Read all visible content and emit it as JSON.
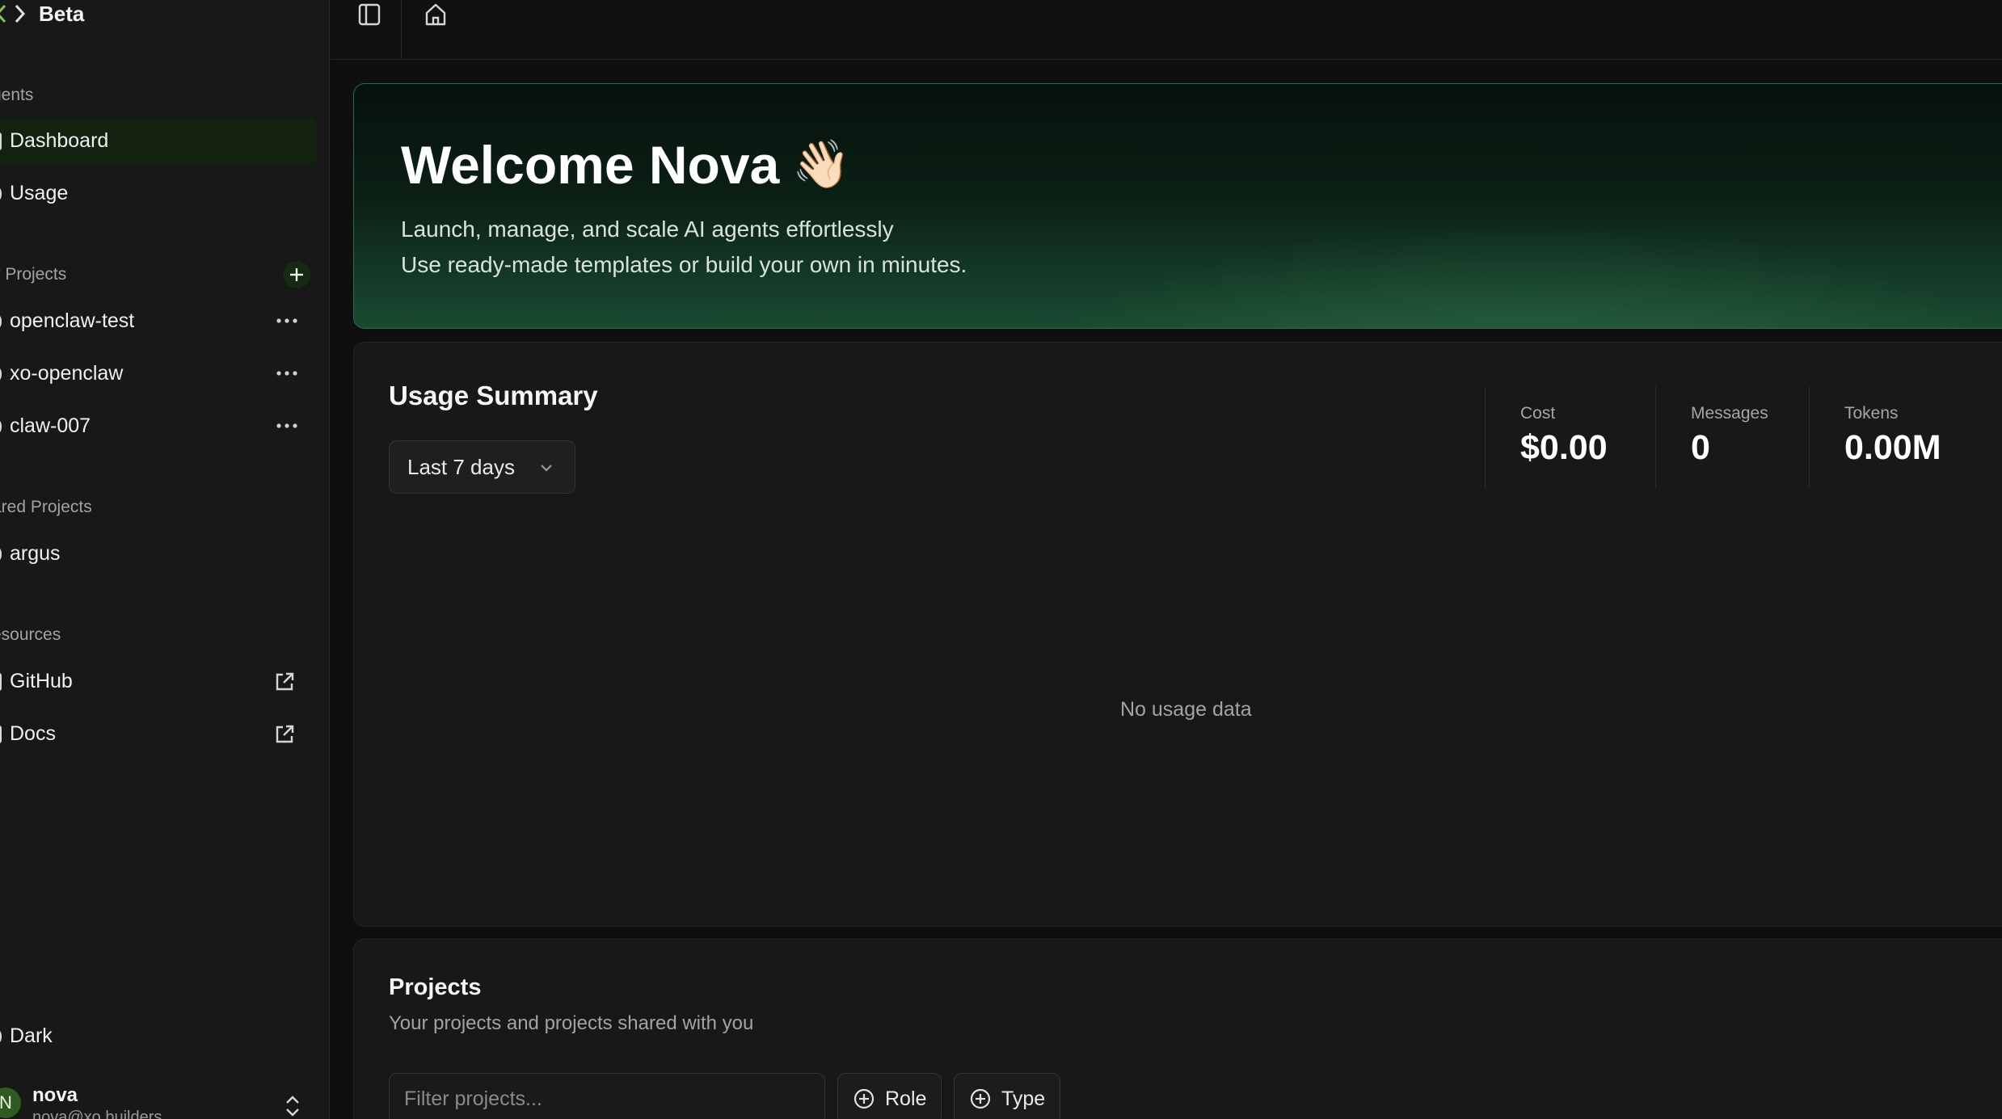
{
  "app": {
    "brand": "Beta"
  },
  "sidebar": {
    "agents_label": "gents",
    "nav": [
      {
        "label": "Dashboard",
        "active": true
      },
      {
        "label": "Usage"
      }
    ],
    "my_projects_label": "y Projects",
    "my_projects": [
      {
        "label": "openclaw-test"
      },
      {
        "label": "xo-openclaw"
      },
      {
        "label": "claw-007"
      }
    ],
    "shared_label": "ared Projects",
    "shared_projects": [
      {
        "label": "argus"
      }
    ],
    "resources_label": "esources",
    "resources": [
      {
        "label": "GitHub",
        "icon": "external-link-icon"
      },
      {
        "label": "Docs",
        "icon": "external-link-icon"
      }
    ],
    "theme_label": "Dark",
    "user": {
      "initial": "N",
      "name": "nova",
      "email": "nova@xo.builders"
    }
  },
  "hero": {
    "title": "Welcome Nova",
    "emoji": "👋🏻",
    "line1": "Launch, manage, and scale AI agents effortlessly",
    "line2": "Use ready-made templates or build your own in minutes."
  },
  "usage": {
    "title": "Usage Summary",
    "range": "Last 7 days",
    "stats": [
      {
        "label": "Cost",
        "value": "$0.00"
      },
      {
        "label": "Messages",
        "value": "0"
      },
      {
        "label": "Tokens",
        "value": "0.00M"
      }
    ],
    "empty": "No usage data"
  },
  "projects": {
    "title": "Projects",
    "subtitle": "Your projects and projects shared with you",
    "filter_placeholder": "Filter projects...",
    "filters": [
      "Role",
      "Type"
    ]
  },
  "colors": {
    "accent": "#2d6a46",
    "active_bg": "#142310",
    "avatar": "#2f5b22"
  }
}
